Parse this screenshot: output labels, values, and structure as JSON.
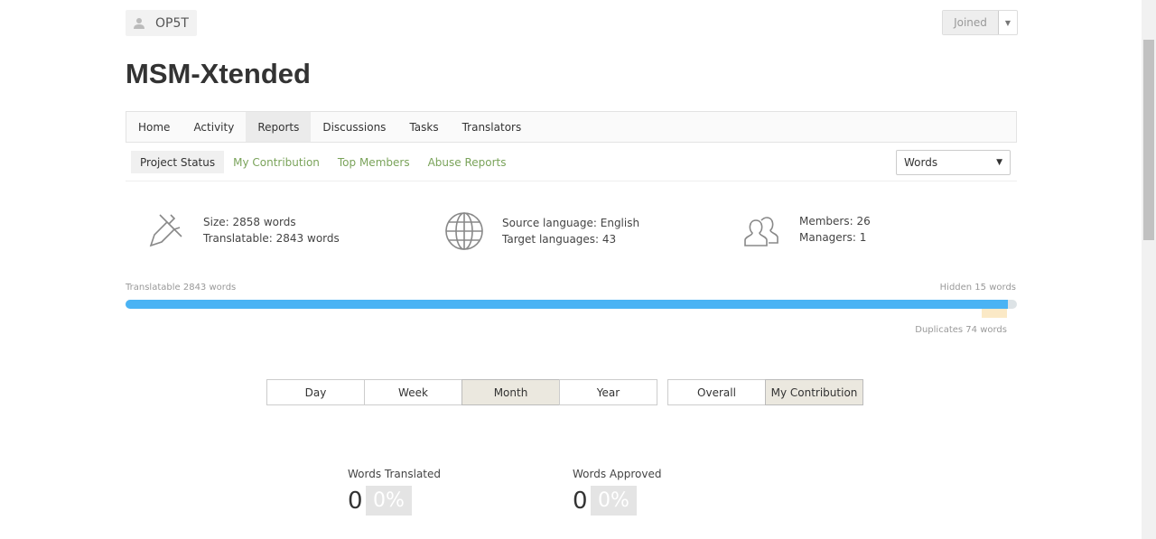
{
  "user": {
    "name": "OP5T",
    "icon": "user-icon"
  },
  "join": {
    "label": "Joined"
  },
  "project": {
    "title": "MSM-Xtended"
  },
  "nav": [
    "Home",
    "Activity",
    "Reports",
    "Discussions",
    "Tasks",
    "Translators"
  ],
  "nav_active": "Reports",
  "subnav": [
    "Project Status",
    "My Contribution",
    "Top Members",
    "Abuse Reports"
  ],
  "subnav_active": "Project Status",
  "unit_select": {
    "value": "Words"
  },
  "stats": {
    "size": "Size: 2858 words",
    "translatable": "Translatable: 2843 words",
    "source": "Source language: English",
    "targets": "Target languages: 43",
    "members": "Members: 26",
    "managers": "Managers: 1"
  },
  "progress": {
    "left_label": "Translatable 2843 words",
    "right_label": "Hidden 15 words",
    "dup_label": "Duplicates 74 words",
    "translatable_fraction": 0.99,
    "bar_color": "#4ab3f4",
    "dup_color": "#fbe9c6"
  },
  "periods": [
    "Day",
    "Week",
    "Month",
    "Year"
  ],
  "period_active": "Month",
  "scope": [
    "Overall",
    "My Contribution"
  ],
  "scope_active": "My Contribution",
  "counters": [
    {
      "label": "Words Translated",
      "value": "0",
      "pct": "0%"
    },
    {
      "label": "Words Approved",
      "value": "0",
      "pct": "0%"
    }
  ],
  "colors": {
    "link": "#7aa35a"
  }
}
